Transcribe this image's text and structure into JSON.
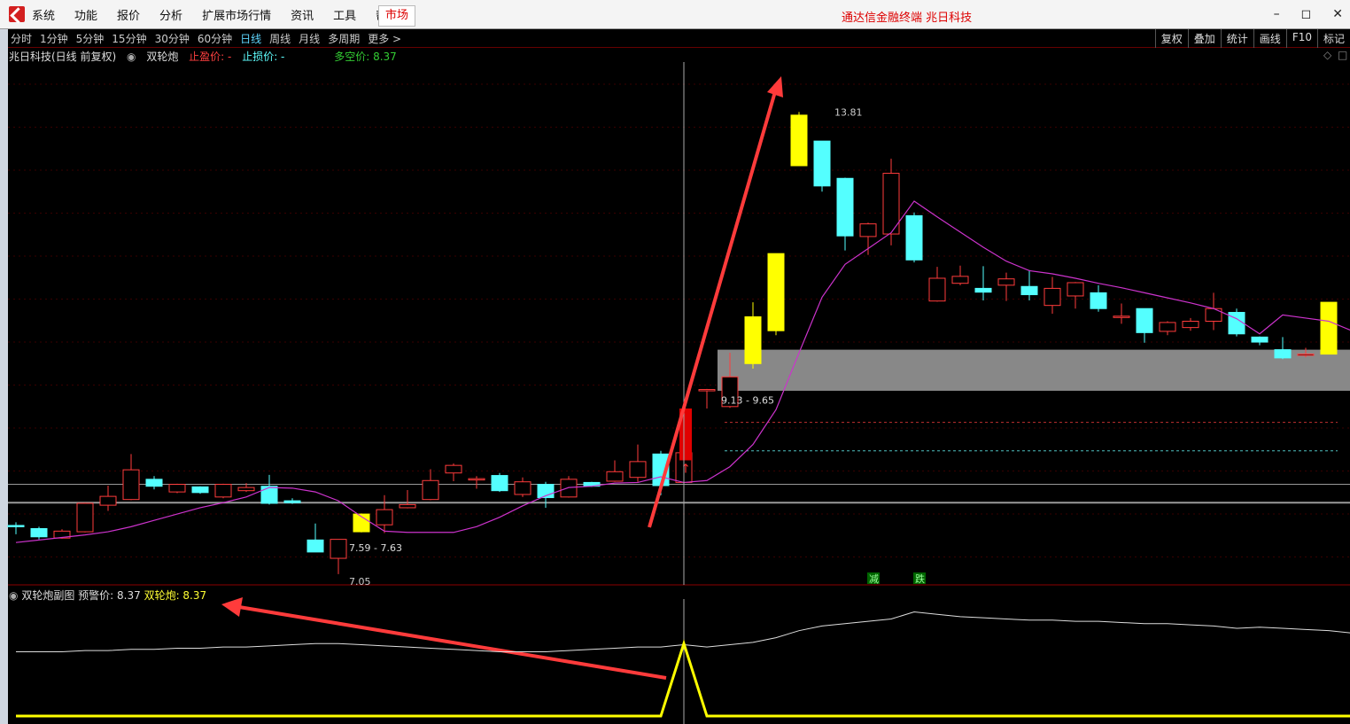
{
  "menubar": {
    "items": [
      "系统",
      "功能",
      "报价",
      "分析",
      "扩展市场行情",
      "资讯",
      "工具",
      "帮助"
    ],
    "market_button": "市场",
    "title": "通达信金融终端  兆日科技"
  },
  "toolbar": {
    "periods": [
      "分时",
      "1分钟",
      "5分钟",
      "15分钟",
      "30分钟",
      "60分钟",
      "日线",
      "周线",
      "月线",
      "多周期",
      "更多 >"
    ],
    "active_period": "日线",
    "right_tools": [
      "复权",
      "叠加",
      "统计",
      "画线",
      "F10",
      "标记"
    ]
  },
  "main_info": {
    "stock": "兆日科技(日线 前复权)",
    "indicator": "双轮炮",
    "stop_profit": "止盈价: -",
    "stop_loss": "止损价: -",
    "long_short": "多空价: 8.37"
  },
  "sub_info": {
    "name": "双轮炮副图",
    "warning": "预警价: 8.37",
    "indicator": "双轮炮: 8.37"
  },
  "chart_data": {
    "type": "candlestick",
    "ylim": [
      6.4,
      14.6
    ],
    "candles": [
      {
        "o": 7.25,
        "h": 7.32,
        "l": 7.13,
        "c": 7.27,
        "color": "cyan"
      },
      {
        "o": 7.22,
        "h": 7.25,
        "l": 7.05,
        "c": 7.09,
        "color": "cyan"
      },
      {
        "o": 7.07,
        "h": 7.21,
        "l": 7.06,
        "c": 7.18,
        "color": "red"
      },
      {
        "o": 7.17,
        "h": 7.63,
        "l": 7.16,
        "c": 7.62,
        "color": "red"
      },
      {
        "o": 7.59,
        "h": 7.9,
        "l": 7.5,
        "c": 7.73,
        "color": "red"
      },
      {
        "o": 7.68,
        "h": 8.4,
        "l": 7.67,
        "c": 8.15,
        "color": "red"
      },
      {
        "o": 8.0,
        "h": 8.05,
        "l": 7.84,
        "c": 7.89,
        "color": "cyan"
      },
      {
        "o": 7.8,
        "h": 7.93,
        "l": 7.78,
        "c": 7.92,
        "color": "red"
      },
      {
        "o": 7.88,
        "h": 7.89,
        "l": 7.77,
        "c": 7.79,
        "color": "cyan"
      },
      {
        "o": 7.72,
        "h": 7.93,
        "l": 7.7,
        "c": 7.92,
        "color": "red"
      },
      {
        "o": 7.82,
        "h": 7.94,
        "l": 7.8,
        "c": 7.87,
        "color": "red"
      },
      {
        "o": 7.89,
        "h": 8.07,
        "l": 7.6,
        "c": 7.62,
        "color": "cyan"
      },
      {
        "o": 7.66,
        "h": 7.7,
        "l": 7.61,
        "c": 7.63,
        "color": "cyan"
      },
      {
        "o": 7.04,
        "h": 7.3,
        "l": 6.87,
        "c": 6.85,
        "color": "cyan"
      },
      {
        "o": 6.75,
        "h": 7.04,
        "l": 6.5,
        "c": 7.05,
        "color": "red"
      },
      {
        "o": 7.17,
        "h": 7.46,
        "l": 7.16,
        "c": 7.45,
        "color": "yellow"
      },
      {
        "o": 7.28,
        "h": 7.75,
        "l": 7.15,
        "c": 7.52,
        "color": "red"
      },
      {
        "o": 7.55,
        "h": 7.83,
        "l": 7.54,
        "c": 7.6,
        "color": "red"
      },
      {
        "o": 7.68,
        "h": 8.16,
        "l": 7.67,
        "c": 7.98,
        "color": "red"
      },
      {
        "o": 8.1,
        "h": 8.25,
        "l": 7.97,
        "c": 8.22,
        "color": "red"
      },
      {
        "o": 8.0,
        "h": 8.05,
        "l": 7.85,
        "c": 8.01,
        "color": "red"
      },
      {
        "o": 8.06,
        "h": 8.1,
        "l": 7.8,
        "c": 7.82,
        "color": "cyan"
      },
      {
        "o": 7.76,
        "h": 8.03,
        "l": 7.72,
        "c": 7.96,
        "color": "red"
      },
      {
        "o": 7.92,
        "h": 7.96,
        "l": 7.55,
        "c": 7.71,
        "color": "cyan"
      },
      {
        "o": 7.72,
        "h": 8.05,
        "l": 7.71,
        "c": 8.0,
        "color": "red"
      },
      {
        "o": 7.95,
        "h": 7.96,
        "l": 7.88,
        "c": 7.89,
        "color": "cyan"
      },
      {
        "o": 7.97,
        "h": 8.3,
        "l": 7.96,
        "c": 8.12,
        "color": "red"
      },
      {
        "o": 8.03,
        "h": 8.55,
        "l": 7.96,
        "c": 8.28,
        "color": "red"
      },
      {
        "o": 8.4,
        "h": 8.45,
        "l": 7.75,
        "c": 7.9,
        "color": "cyan"
      },
      {
        "o": 7.95,
        "h": 8.41,
        "l": 7.8,
        "c": 8.42,
        "color": "red"
      },
      {
        "o": 9.42,
        "h": 9.43,
        "l": 9.12,
        "c": 9.42,
        "color": "red"
      },
      {
        "o": 9.15,
        "h": 10.0,
        "l": 9.13,
        "c": 9.62,
        "color": "red"
      },
      {
        "o": 9.83,
        "h": 10.8,
        "l": 9.75,
        "c": 10.57,
        "color": "yellow"
      },
      {
        "o": 10.35,
        "h": 11.57,
        "l": 10.28,
        "c": 11.57,
        "color": "yellow"
      },
      {
        "o": 12.96,
        "h": 13.81,
        "l": 12.96,
        "c": 13.76,
        "color": "yellow"
      },
      {
        "o": 13.35,
        "h": 13.35,
        "l": 12.55,
        "c": 12.64,
        "color": "cyan"
      },
      {
        "o": 12.76,
        "h": 12.77,
        "l": 11.62,
        "c": 11.85,
        "color": "cyan"
      },
      {
        "o": 11.84,
        "h": 12.06,
        "l": 11.55,
        "c": 12.04,
        "color": "red"
      },
      {
        "o": 11.88,
        "h": 13.07,
        "l": 11.7,
        "c": 12.84,
        "color": "red"
      },
      {
        "o": 12.17,
        "h": 12.22,
        "l": 11.43,
        "c": 11.47,
        "color": "cyan"
      },
      {
        "o": 10.82,
        "h": 11.36,
        "l": 10.81,
        "c": 11.18,
        "color": "red"
      },
      {
        "o": 11.1,
        "h": 11.38,
        "l": 11.07,
        "c": 11.21,
        "color": "red"
      },
      {
        "o": 11.02,
        "h": 11.37,
        "l": 10.83,
        "c": 10.96,
        "color": "cyan"
      },
      {
        "o": 11.07,
        "h": 11.27,
        "l": 10.82,
        "c": 11.17,
        "color": "red"
      },
      {
        "o": 11.05,
        "h": 11.31,
        "l": 10.83,
        "c": 10.92,
        "color": "cyan"
      },
      {
        "o": 10.75,
        "h": 11.2,
        "l": 10.62,
        "c": 11.02,
        "color": "red"
      },
      {
        "o": 10.9,
        "h": 11.12,
        "l": 10.7,
        "c": 11.11,
        "color": "red"
      },
      {
        "o": 10.95,
        "h": 11.07,
        "l": 10.65,
        "c": 10.7,
        "color": "cyan"
      },
      {
        "o": 10.57,
        "h": 10.78,
        "l": 10.46,
        "c": 10.58,
        "color": "red"
      },
      {
        "o": 10.7,
        "h": 10.7,
        "l": 10.16,
        "c": 10.32,
        "color": "cyan"
      },
      {
        "o": 10.34,
        "h": 10.5,
        "l": 10.28,
        "c": 10.48,
        "color": "red"
      },
      {
        "o": 10.4,
        "h": 10.55,
        "l": 10.35,
        "c": 10.5,
        "color": "red"
      },
      {
        "o": 10.5,
        "h": 10.95,
        "l": 10.36,
        "c": 10.7,
        "color": "red"
      },
      {
        "o": 10.64,
        "h": 10.7,
        "l": 10.26,
        "c": 10.3,
        "color": "cyan"
      },
      {
        "o": 10.25,
        "h": 10.26,
        "l": 10.12,
        "c": 10.17,
        "color": "cyan"
      },
      {
        "o": 10.05,
        "h": 10.25,
        "l": 9.9,
        "c": 9.92,
        "color": "cyan"
      },
      {
        "o": 9.97,
        "h": 10.08,
        "l": 9.93,
        "c": 9.98,
        "color": "red"
      },
      {
        "o": 9.98,
        "h": 10.8,
        "l": 9.98,
        "c": 10.8,
        "color": "yellow"
      }
    ],
    "ma": [
      7.0,
      7.04,
      7.08,
      7.12,
      7.17,
      7.25,
      7.35,
      7.45,
      7.55,
      7.63,
      7.72,
      7.87,
      7.86,
      7.8,
      7.66,
      7.41,
      7.18,
      7.16,
      7.16,
      7.16,
      7.25,
      7.4,
      7.58,
      7.74,
      7.87,
      7.89,
      7.94,
      7.95,
      8.04,
      7.95,
      7.98,
      8.2,
      8.55,
      9.1,
      10.0,
      10.88,
      11.4,
      11.65,
      11.9,
      12.4,
      12.15,
      11.91,
      11.67,
      11.45,
      11.3,
      11.25,
      11.18,
      11.1,
      11.03,
      10.95,
      10.87,
      10.79,
      10.7,
      10.54,
      10.3,
      10.6,
      10.55,
      10.5,
      10.35
    ],
    "labels": {
      "high": "13.81",
      "low": "7.05",
      "range_lower": "7.59 - 7.63",
      "range_upper": "9.13 - 9.65",
      "signal1": "减",
      "signal2": "跌"
    },
    "sub": {
      "white": [
        0.58,
        0.58,
        0.58,
        0.59,
        0.59,
        0.6,
        0.6,
        0.61,
        0.61,
        0.62,
        0.62,
        0.63,
        0.64,
        0.65,
        0.65,
        0.64,
        0.63,
        0.62,
        0.61,
        0.6,
        0.59,
        0.58,
        0.58,
        0.58,
        0.59,
        0.6,
        0.61,
        0.62,
        0.62,
        0.64,
        0.62,
        0.64,
        0.66,
        0.7,
        0.76,
        0.8,
        0.82,
        0.84,
        0.86,
        0.92,
        0.9,
        0.88,
        0.87,
        0.86,
        0.85,
        0.85,
        0.84,
        0.84,
        0.83,
        0.82,
        0.82,
        0.81,
        0.8,
        0.78,
        0.79,
        0.78,
        0.77,
        0.76,
        0.74
      ],
      "yellow": [
        0.03,
        0.03,
        0.03,
        0.03,
        0.03,
        0.03,
        0.03,
        0.03,
        0.03,
        0.03,
        0.03,
        0.03,
        0.03,
        0.03,
        0.03,
        0.03,
        0.03,
        0.03,
        0.03,
        0.03,
        0.03,
        0.03,
        0.03,
        0.03,
        0.03,
        0.03,
        0.03,
        0.03,
        0.03,
        0.65,
        0.03,
        0.03,
        0.03,
        0.03,
        0.03,
        0.03,
        0.03,
        0.03,
        0.03,
        0.03,
        0.03,
        0.03,
        0.03,
        0.03,
        0.03,
        0.03,
        0.03,
        0.03,
        0.03,
        0.03,
        0.03,
        0.03,
        0.03,
        0.03,
        0.03,
        0.03,
        0.03,
        0.03,
        0.03
      ]
    },
    "colors": {
      "red": "#ff3b3b",
      "cyan": "#54ffff",
      "yellow": "#ffff00",
      "ma": "#cc33cc",
      "bg": "#000000"
    }
  }
}
